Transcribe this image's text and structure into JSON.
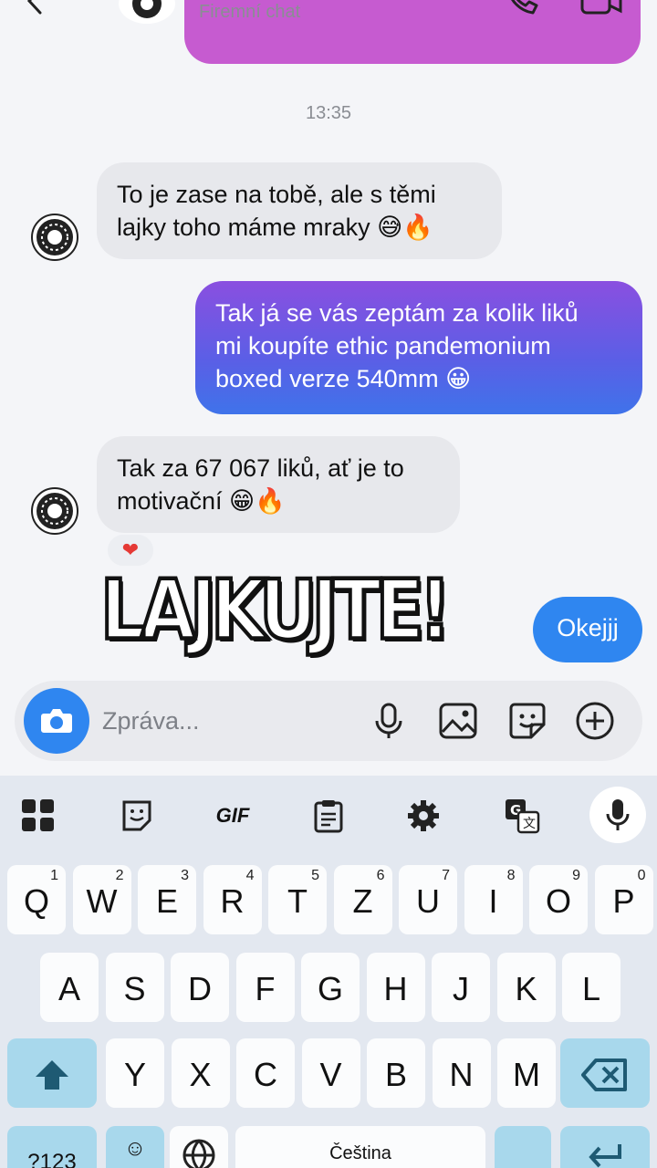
{
  "header": {
    "subtitle": "Firemní chat"
  },
  "messages": {
    "timestamp": "13:35",
    "m1": {
      "line1": "To je zase na tobě, ale s těmi",
      "line2": "lajky toho máme mraky 😅🔥"
    },
    "m2": {
      "line1": "Tak já se vás zeptám za kolik liků",
      "line2": "mi koupíte ethic pandemonium",
      "line3": "boxed verze 540mm 😀"
    },
    "m3": {
      "line1": "Tak za 67 067 liků, ať je to",
      "line2": "motivační 😁🔥"
    },
    "reaction": "❤",
    "sticker": "LAJKUJTE!",
    "m4": "Okejjj"
  },
  "input": {
    "placeholder": "Zpráva..."
  },
  "keyboard": {
    "toolbar": {
      "gif": "GIF"
    },
    "row1": [
      {
        "k": "Q",
        "h": "1"
      },
      {
        "k": "W",
        "h": "2"
      },
      {
        "k": "E",
        "h": "3"
      },
      {
        "k": "R",
        "h": "4"
      },
      {
        "k": "T",
        "h": "5"
      },
      {
        "k": "Z",
        "h": "6"
      },
      {
        "k": "U",
        "h": "7"
      },
      {
        "k": "I",
        "h": "8"
      },
      {
        "k": "O",
        "h": "9"
      },
      {
        "k": "P",
        "h": "0"
      }
    ],
    "row2": [
      "A",
      "S",
      "D",
      "F",
      "G",
      "H",
      "J",
      "K",
      "L"
    ],
    "row3": [
      "Y",
      "X",
      "C",
      "V",
      "B",
      "N",
      "M"
    ],
    "numbers_key": "?123",
    "emoji_key": "☺",
    "space_label": "Čeština"
  },
  "colors": {
    "accent": "#2f86f0",
    "outgoing_gradient_top": "#8a4fe0",
    "outgoing_gradient_bottom": "#3f73ea",
    "incoming_bubble": "#e7e8ec",
    "modifier_key": "#a8d8ec"
  }
}
